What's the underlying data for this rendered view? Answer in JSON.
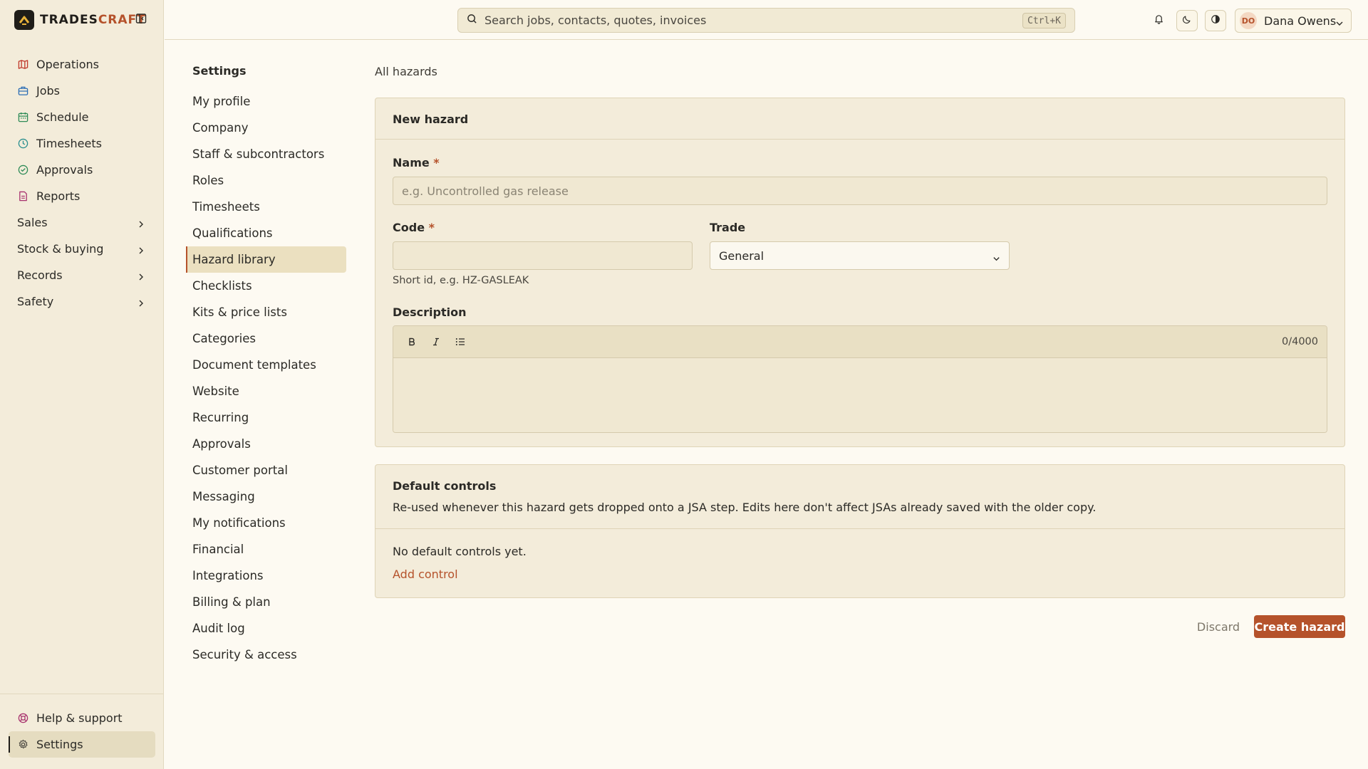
{
  "app": {
    "brand_part1": "TRADES",
    "brand_part2": "CRAFT",
    "accent_color": "#b5522b"
  },
  "sidebar": {
    "items": [
      {
        "label": "Operations",
        "icon": "map-icon",
        "color": "#c0392b"
      },
      {
        "label": "Jobs",
        "icon": "briefcase-icon",
        "color": "#2e6fb5"
      },
      {
        "label": "Schedule",
        "icon": "calendar-icon",
        "color": "#2e8b57"
      },
      {
        "label": "Timesheets",
        "icon": "clock-icon",
        "color": "#2a8f8f"
      },
      {
        "label": "Approvals",
        "icon": "check-circle-icon",
        "color": "#2e8b57"
      },
      {
        "label": "Reports",
        "icon": "file-icon",
        "color": "#a8326e"
      }
    ],
    "groups": [
      "Sales",
      "Stock & buying",
      "Records",
      "Safety"
    ],
    "bottom": [
      {
        "label": "Help & support",
        "icon": "lifebuoy-icon"
      },
      {
        "label": "Settings",
        "icon": "gear-icon",
        "active": true
      }
    ]
  },
  "topbar": {
    "search_placeholder": "Search jobs, contacts, quotes, invoices",
    "shortcut": "Ctrl+K",
    "user_initials": "DO",
    "user_name": "Dana Owens"
  },
  "settings_nav": {
    "title": "Settings",
    "items": [
      "My profile",
      "Company",
      "Staff & subcontractors",
      "Roles",
      "Timesheets",
      "Qualifications",
      "Hazard library",
      "Checklists",
      "Kits & price lists",
      "Categories",
      "Document templates",
      "Website",
      "Recurring",
      "Approvals",
      "Customer portal",
      "Messaging",
      "My notifications",
      "Financial",
      "Integrations",
      "Billing & plan",
      "Audit log",
      "Security & access"
    ],
    "active": "Hazard library"
  },
  "main": {
    "breadcrumb": "All hazards",
    "form": {
      "title": "New hazard",
      "name_label": "Name",
      "name_placeholder": "e.g. Uncontrolled gas release",
      "name_value": "",
      "code_label": "Code",
      "code_value": "",
      "code_hint": "Short id, e.g. HZ-GASLEAK",
      "trade_label": "Trade",
      "trade_value": "General",
      "description_label": "Description",
      "description_counter": "0/4000",
      "required_marker": "*"
    },
    "controls": {
      "title": "Default controls",
      "description": "Re-used whenever this hazard gets dropped onto a JSA step. Edits here don't affect JSAs already saved with the older copy.",
      "empty": "No default controls yet.",
      "add_label": "Add control"
    },
    "actions": {
      "discard": "Discard",
      "create": "Create hazard"
    }
  }
}
